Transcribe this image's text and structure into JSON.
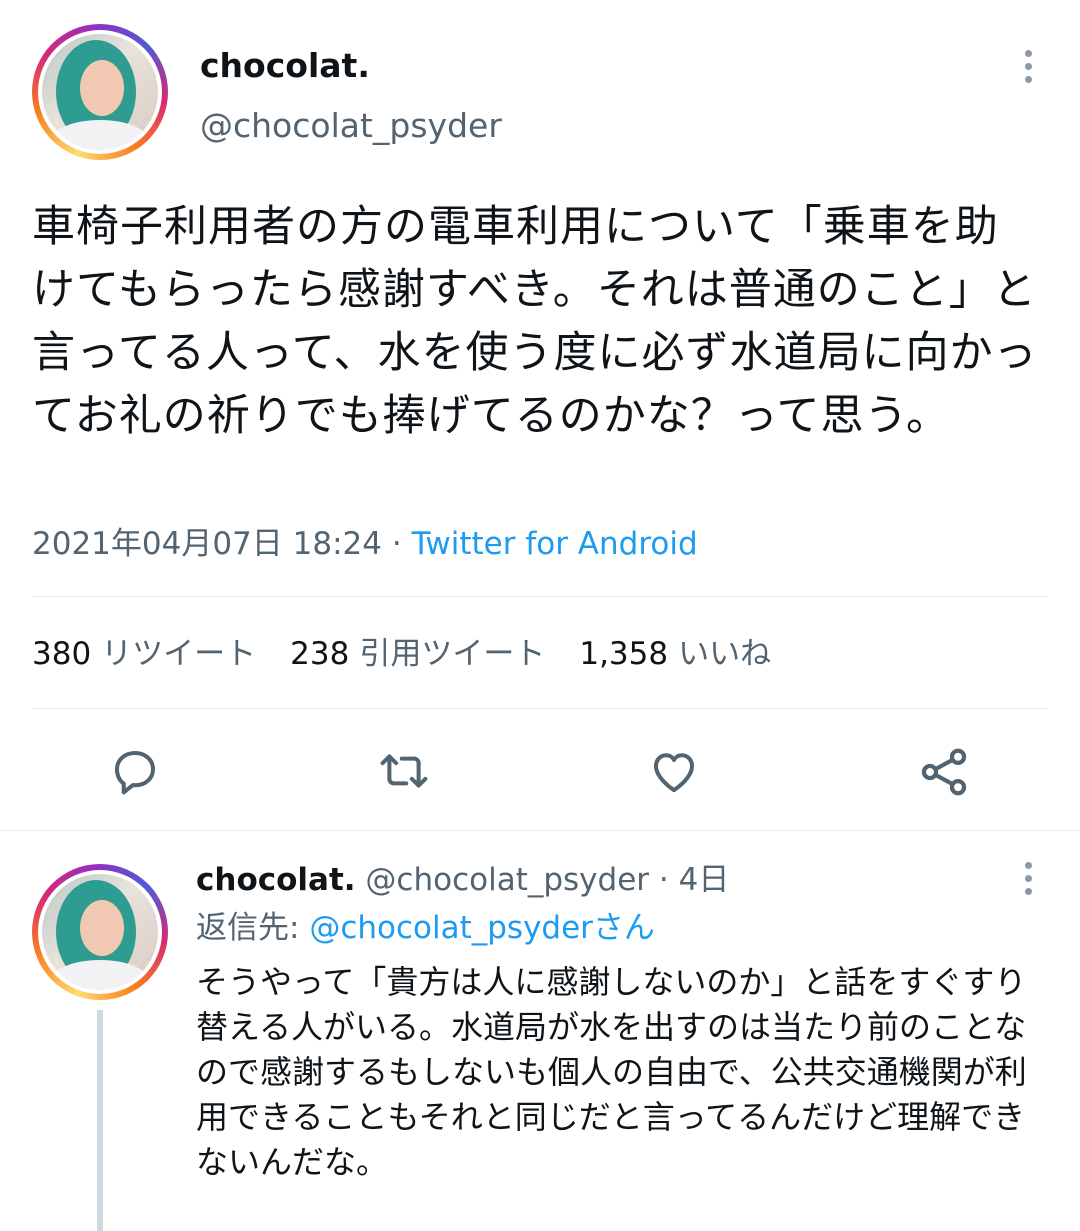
{
  "main_tweet": {
    "display_name": "chocolat.",
    "handle": "@chocolat_psyder",
    "text": "車椅子利用者の方の電車利用について「乗車を助けてもらったら感謝すべき。それは普通のこと」と言ってる人って、水を使う度に必ず水道局に向かってお礼の祈りでも捧げてるのかな？って思う。",
    "date": "2021年04月07日 18:24",
    "separator": "·",
    "source": "Twitter for Android",
    "stats": [
      {
        "count": "380",
        "label": "リツイート"
      },
      {
        "count": "238",
        "label": "引用ツイート"
      },
      {
        "count": "1,358",
        "label": "いいね"
      }
    ],
    "actions": {
      "reply": "reply-icon",
      "retweet": "retweet-icon",
      "like": "heart-icon",
      "share": "share-icon"
    }
  },
  "reply_tweet": {
    "display_name": "chocolat.",
    "handle": "@chocolat_psyder",
    "separator": "·",
    "time": "4日",
    "reply_to_label": "返信先:",
    "reply_to_handle": "@chocolat_psyderさん",
    "text": "そうやって「貴方は人に感謝しないのか」と話をすぐすり替える人がいる。水道局が水を出すのは当たり前のことなので感謝するもしないも個人の自由で、公共交通機関が利用できることもそれと同じだと言ってるんだけど理解できないんだな。"
  },
  "colors": {
    "accent": "#1d9bf0",
    "muted": "#536471",
    "text": "#0f1419",
    "divider": "#e6ecf0",
    "icon": "#536471"
  }
}
